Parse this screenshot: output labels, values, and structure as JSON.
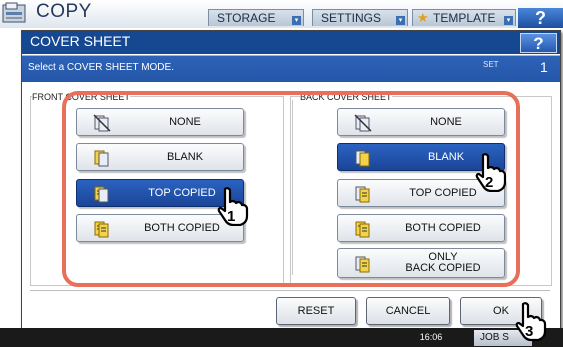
{
  "app": {
    "title": "COPY"
  },
  "top_tabs": [
    {
      "label": "STORAGE"
    },
    {
      "label": "SETTINGS"
    },
    {
      "label": "TEMPLATE"
    }
  ],
  "help_label": "?",
  "dialog": {
    "title": "COVER SHEET",
    "message": "Select a COVER SHEET MODE.",
    "set_label": "SET",
    "set_value": "1",
    "help_label": "?"
  },
  "front": {
    "label": "FRONT COVER SHEET",
    "options": [
      {
        "label": "NONE",
        "selected": false
      },
      {
        "label": "BLANK",
        "selected": false
      },
      {
        "label": "TOP COPIED",
        "selected": true
      },
      {
        "label": "BOTH COPIED",
        "selected": false
      }
    ]
  },
  "back": {
    "label": "BACK COVER SHEET",
    "options": [
      {
        "label": "NONE",
        "selected": false
      },
      {
        "label": "BLANK",
        "selected": true
      },
      {
        "label": "TOP COPIED",
        "selected": false
      },
      {
        "label": "BOTH COPIED",
        "selected": false
      },
      {
        "label_line1": "ONLY",
        "label_line2": "BACK COPIED",
        "selected": false
      }
    ]
  },
  "buttons": {
    "reset": "RESET",
    "cancel": "CANCEL",
    "ok": "OK"
  },
  "steps": [
    "1",
    "2",
    "3"
  ],
  "status": {
    "time": "16:06",
    "job_status": "JOB S"
  },
  "colors": {
    "header_blue": "#164891",
    "selected_blue": "#2459b4",
    "highlight": "#e8705a"
  }
}
